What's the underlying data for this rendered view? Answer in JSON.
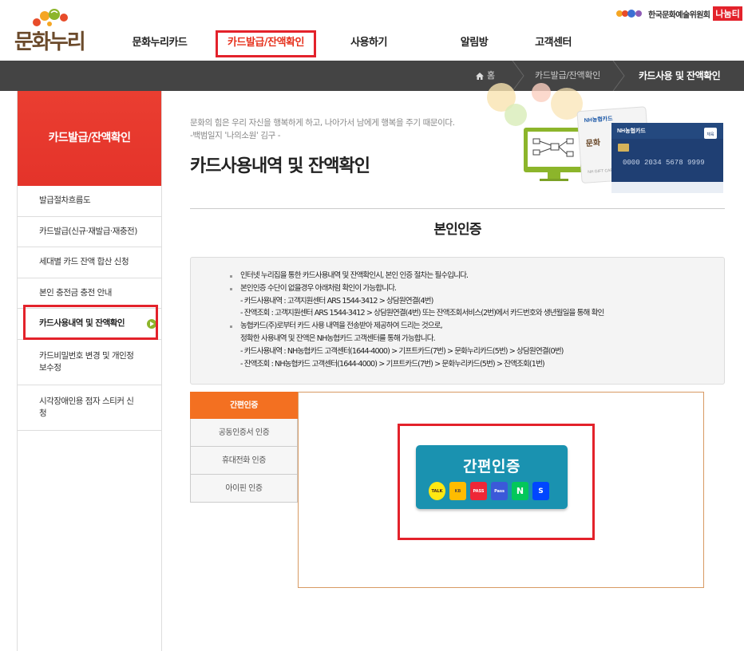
{
  "header": {
    "logo_text": "문화누리",
    "nav": [
      {
        "label": "문화누리카드"
      },
      {
        "label": "카드발급/잔액확인"
      },
      {
        "label": "사용하기"
      },
      {
        "label": "알림방"
      },
      {
        "label": "고객센터"
      }
    ],
    "partner_text": "한국문화예술위원회",
    "partner_logo": "나눔티"
  },
  "location": {
    "home": "홈",
    "crumb": "카드발급/잔액확인",
    "current": "카드사용 및 잔액확인"
  },
  "sidebar": {
    "title": "카드발급/잔액확인",
    "items": [
      {
        "label": "발급절차흐름도"
      },
      {
        "label": "카드발급(신규·재발급·재충전)"
      },
      {
        "label": "세대별 카드 잔액 합산 신청"
      },
      {
        "label": "본인 충전금 충전 안내"
      },
      {
        "label": "카드사용내역 및 잔액확인"
      },
      {
        "label": "카드비밀번호 변경 및 개인정보수정"
      },
      {
        "label": "시각장애인용 점자 스티커 신청"
      }
    ]
  },
  "main": {
    "quote_line1": "문화의 힘은 우리 자신을 행복하게 하고, 나아가서 남에게 행복을 주기 때문이다.",
    "quote_line2": "-백범일지 '나의소원' 김구 -",
    "title": "카드사용내역 및 잔액확인",
    "section_title": "본인인증",
    "card_brand": "NH농협카드",
    "card_number": "0000  2034  5678  9999",
    "info": [
      "인터넷 누리집을 통한 카드사용내역 및 잔액확인시, 본인 인증 절차는 필수입니다.",
      "본인인증 수단이 없을경우 아래처럼 확인이 가능합니다.",
      "- 카드사용내역 : 고객지원센터 ARS 1544-3412 > 상담원연결(4번)",
      "- 잔액조회 : 고객지원센터 ARS 1544-3412 > 상담원연결(4번) 또는 잔액조회서비스(2번)에서 카드번호와 생년월일을 통해 확인",
      "농협카드(주)로부터 카드 사용 내역을 전송받아 제공하여 드리는 것으로,",
      "정확한 사용내역 및 잔액은 NH농협카드 고객센터를 통해 가능합니다.",
      "- 카드사용내역 : NH농협카드 고객센터(1644-4000) > 기프트카드(7번) > 문화누리카드(5번) > 상담원연결(0번)",
      "- 잔액조회 : NH농협카드 고객센터(1644-4000) > 기프트카드(7번) > 문화누리카드(5번) > 잔액조회(1번)"
    ]
  },
  "auth": {
    "tabs": [
      {
        "label": "간편인증"
      },
      {
        "label": "공동인증서 인증"
      },
      {
        "label": "휴대전화 인증"
      },
      {
        "label": "아이핀 인증"
      }
    ],
    "button_label": "간편인증",
    "providers": [
      {
        "name": "kakao",
        "label": "TALK",
        "bg": "#ffe812",
        "fg": "#3c1e1e"
      },
      {
        "name": "kb",
        "label": "KB",
        "bg": "#ffbc00",
        "fg": "#5a4a3a"
      },
      {
        "name": "pass-red",
        "label": "PASS",
        "bg": "#ee2737",
        "fg": "#ffffff"
      },
      {
        "name": "pass",
        "label": "Pass",
        "bg": "#3b59d9",
        "fg": "#ffffff"
      },
      {
        "name": "naver",
        "label": "N",
        "bg": "#03c75a",
        "fg": "#ffffff"
      },
      {
        "name": "shinhan",
        "label": "S",
        "bg": "#0046ff",
        "fg": "#ffffff"
      }
    ]
  },
  "colors": {
    "accent_red": "#e3222b",
    "sidebar_red": "#e4332a",
    "tab_orange": "#f37021",
    "auth_teal": "#1a92b0",
    "location_bar": "#444444"
  }
}
